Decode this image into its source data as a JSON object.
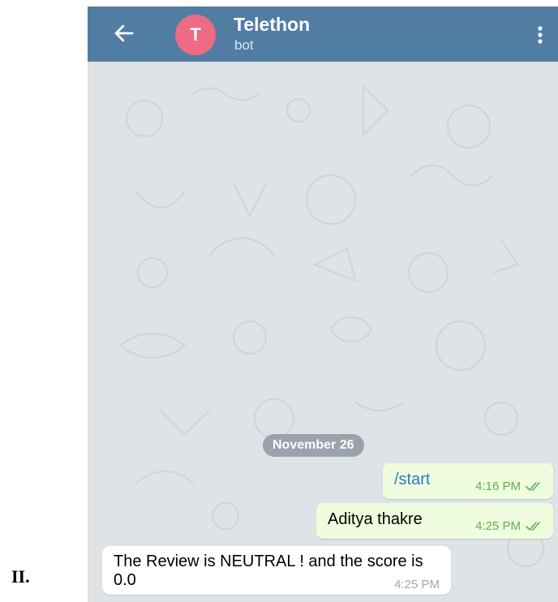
{
  "section_label": "II.",
  "header": {
    "avatar_letter": "T",
    "title": "Telethon",
    "subtitle": "bot",
    "colors": {
      "bar": "#527da3",
      "avatar": "#ed6b84"
    },
    "icons": {
      "back": "arrow-left-icon",
      "menu": "more-vertical-icon"
    }
  },
  "chat": {
    "date_divider": "November 26",
    "messages": [
      {
        "direction": "outgoing",
        "text": "/start",
        "time": "4:16 PM",
        "status": "read-double-check"
      },
      {
        "direction": "outgoing",
        "text": "Aditya thakre",
        "time": "4:25 PM",
        "status": "read-double-check"
      },
      {
        "direction": "incoming",
        "text": "The Review is NEUTRAL ! and the score is 0.0",
        "time": "4:25 PM"
      }
    ],
    "colors": {
      "outgoing_bubble": "#effdde",
      "incoming_bubble": "#ffffff",
      "wallpaper": "#dfe3e6"
    }
  }
}
